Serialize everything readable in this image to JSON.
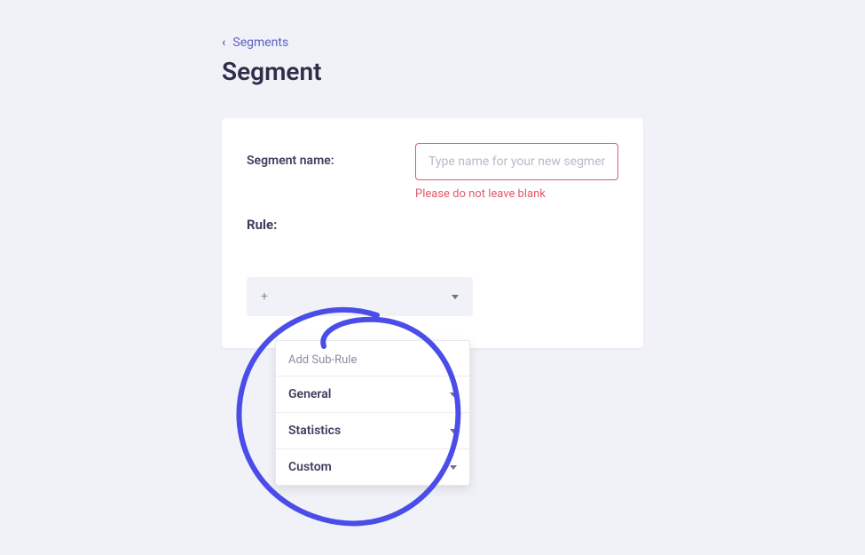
{
  "breadcrumb": {
    "label": "Segments"
  },
  "page": {
    "title": "Segment"
  },
  "form": {
    "segmentName": {
      "label": "Segment name:",
      "placeholder": "Type name for your new segment",
      "value": "",
      "error": "Please do not leave blank"
    },
    "rule": {
      "label": "Rule:"
    }
  },
  "ruleDropdown": {
    "plusLabel": "+"
  },
  "dropdown": {
    "header": "Add Sub-Rule",
    "items": [
      {
        "label": "General"
      },
      {
        "label": "Statistics"
      },
      {
        "label": "Custom"
      }
    ]
  }
}
